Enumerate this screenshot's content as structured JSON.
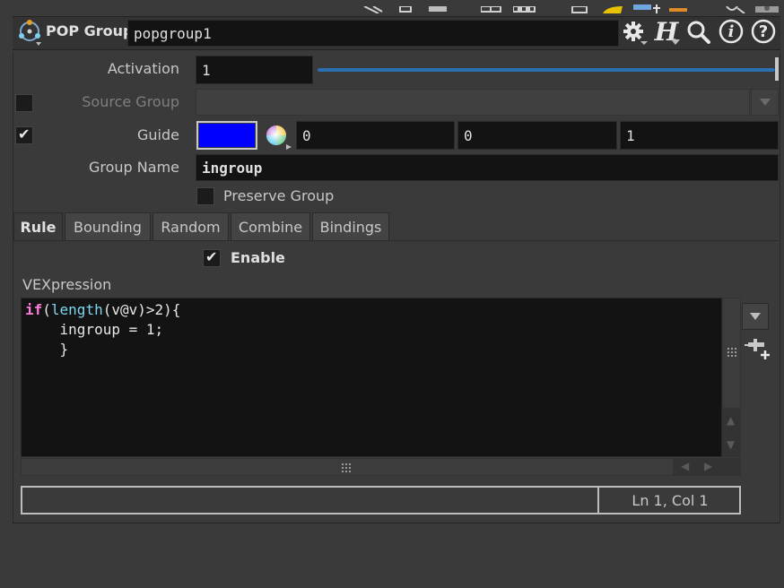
{
  "header": {
    "node_type": "POP Group",
    "node_name": "popgroup1",
    "icons": [
      "gear-icon",
      "houdini-help-icon",
      "search-icon",
      "info-icon",
      "help-icon"
    ],
    "help_glyph": "H",
    "info_glyph": "i",
    "question_glyph": "?"
  },
  "params": {
    "activation": {
      "label": "Activation",
      "value": "1",
      "slider_fraction": 1.0
    },
    "source_group": {
      "label": "Source Group",
      "value": "",
      "enabled": false
    },
    "guide": {
      "label": "Guide",
      "checked": true,
      "color": "#0000ff",
      "r": "0",
      "g": "0",
      "b": "1"
    },
    "group_name": {
      "label": "Group Name",
      "value": "ingroup"
    },
    "preserve_group": {
      "label": "Preserve Group",
      "checked": false
    }
  },
  "tabs": [
    {
      "label": "Rule",
      "active": true
    },
    {
      "label": "Bounding",
      "active": false
    },
    {
      "label": "Random",
      "active": false
    },
    {
      "label": "Combine",
      "active": false
    },
    {
      "label": "Bindings",
      "active": false
    }
  ],
  "rule": {
    "enable_label": "Enable",
    "enable_checked": true,
    "vex_label": "VEXpression",
    "code_lines": [
      "if(length(v@v)>2){",
      "    ingroup = 1;",
      "    }"
    ],
    "status_position": "Ln 1, Col 1"
  },
  "colors": {
    "background": "#3a3a3a",
    "field": "#131313",
    "keyword": "#ff7ad9",
    "function": "#7fd6f0",
    "slider": "#2a6fb0"
  }
}
